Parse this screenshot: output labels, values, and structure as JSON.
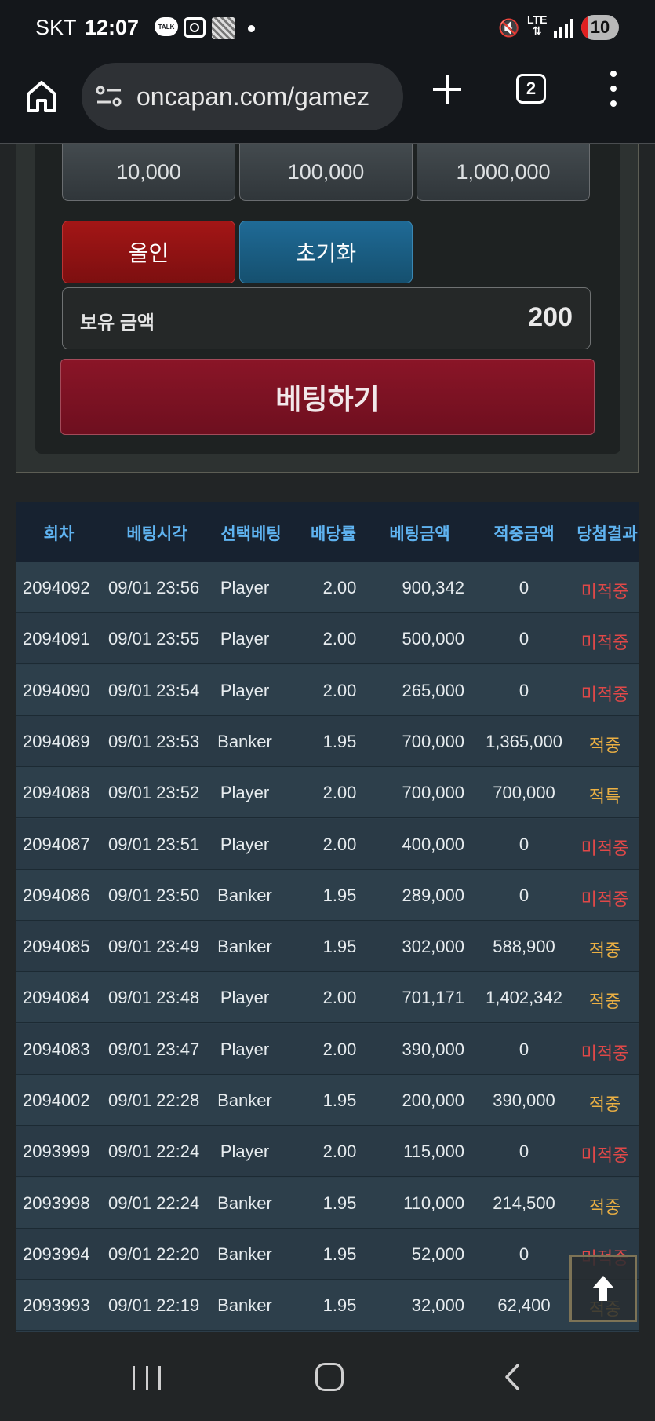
{
  "status_bar": {
    "carrier": "SKT",
    "time": "12:07",
    "talk": "TALK",
    "network": "LTE",
    "battery": "10"
  },
  "browser": {
    "url": "oncapan.com/gamez",
    "tab_count": "2"
  },
  "bet_panel": {
    "amounts": [
      "10,000",
      "100,000",
      "1,000,000"
    ],
    "allin_label": "올인",
    "reset_label": "초기화",
    "balance_label": "보유 금액",
    "balance_value": "200",
    "bet_label": "베팅하기"
  },
  "history": {
    "headers": [
      "회차",
      "베팅시각",
      "선택베팅",
      "배당률",
      "베팅금액",
      "적중금액",
      "당첨결과"
    ],
    "rows": [
      {
        "round": "2094092",
        "time": "09/01 23:56",
        "pick": "Player",
        "odds": "2.00",
        "bet": "900,342",
        "win": "0",
        "result": "미적중",
        "status": "lose"
      },
      {
        "round": "2094091",
        "time": "09/01 23:55",
        "pick": "Player",
        "odds": "2.00",
        "bet": "500,000",
        "win": "0",
        "result": "미적중",
        "status": "lose"
      },
      {
        "round": "2094090",
        "time": "09/01 23:54",
        "pick": "Player",
        "odds": "2.00",
        "bet": "265,000",
        "win": "0",
        "result": "미적중",
        "status": "lose"
      },
      {
        "round": "2094089",
        "time": "09/01 23:53",
        "pick": "Banker",
        "odds": "1.95",
        "bet": "700,000",
        "win": "1,365,000",
        "result": "적중",
        "status": "win"
      },
      {
        "round": "2094088",
        "time": "09/01 23:52",
        "pick": "Player",
        "odds": "2.00",
        "bet": "700,000",
        "win": "700,000",
        "result": "적특",
        "status": "win"
      },
      {
        "round": "2094087",
        "time": "09/01 23:51",
        "pick": "Player",
        "odds": "2.00",
        "bet": "400,000",
        "win": "0",
        "result": "미적중",
        "status": "lose"
      },
      {
        "round": "2094086",
        "time": "09/01 23:50",
        "pick": "Banker",
        "odds": "1.95",
        "bet": "289,000",
        "win": "0",
        "result": "미적중",
        "status": "lose"
      },
      {
        "round": "2094085",
        "time": "09/01 23:49",
        "pick": "Banker",
        "odds": "1.95",
        "bet": "302,000",
        "win": "588,900",
        "result": "적중",
        "status": "win"
      },
      {
        "round": "2094084",
        "time": "09/01 23:48",
        "pick": "Player",
        "odds": "2.00",
        "bet": "701,171",
        "win": "1,402,342",
        "result": "적중",
        "status": "win"
      },
      {
        "round": "2094083",
        "time": "09/01 23:47",
        "pick": "Player",
        "odds": "2.00",
        "bet": "390,000",
        "win": "0",
        "result": "미적중",
        "status": "lose"
      },
      {
        "round": "2094002",
        "time": "09/01 22:28",
        "pick": "Banker",
        "odds": "1.95",
        "bet": "200,000",
        "win": "390,000",
        "result": "적중",
        "status": "win"
      },
      {
        "round": "2093999",
        "time": "09/01 22:24",
        "pick": "Player",
        "odds": "2.00",
        "bet": "115,000",
        "win": "0",
        "result": "미적중",
        "status": "lose"
      },
      {
        "round": "2093998",
        "time": "09/01 22:24",
        "pick": "Banker",
        "odds": "1.95",
        "bet": "110,000",
        "win": "214,500",
        "result": "적중",
        "status": "win"
      },
      {
        "round": "2093994",
        "time": "09/01 22:20",
        "pick": "Banker",
        "odds": "1.95",
        "bet": "52,000",
        "win": "0",
        "result": "미적중",
        "status": "lose"
      },
      {
        "round": "2093993",
        "time": "09/01 22:19",
        "pick": "Banker",
        "odds": "1.95",
        "bet": "32,000",
        "win": "62,400",
        "result": "적중",
        "status": "win"
      }
    ]
  }
}
